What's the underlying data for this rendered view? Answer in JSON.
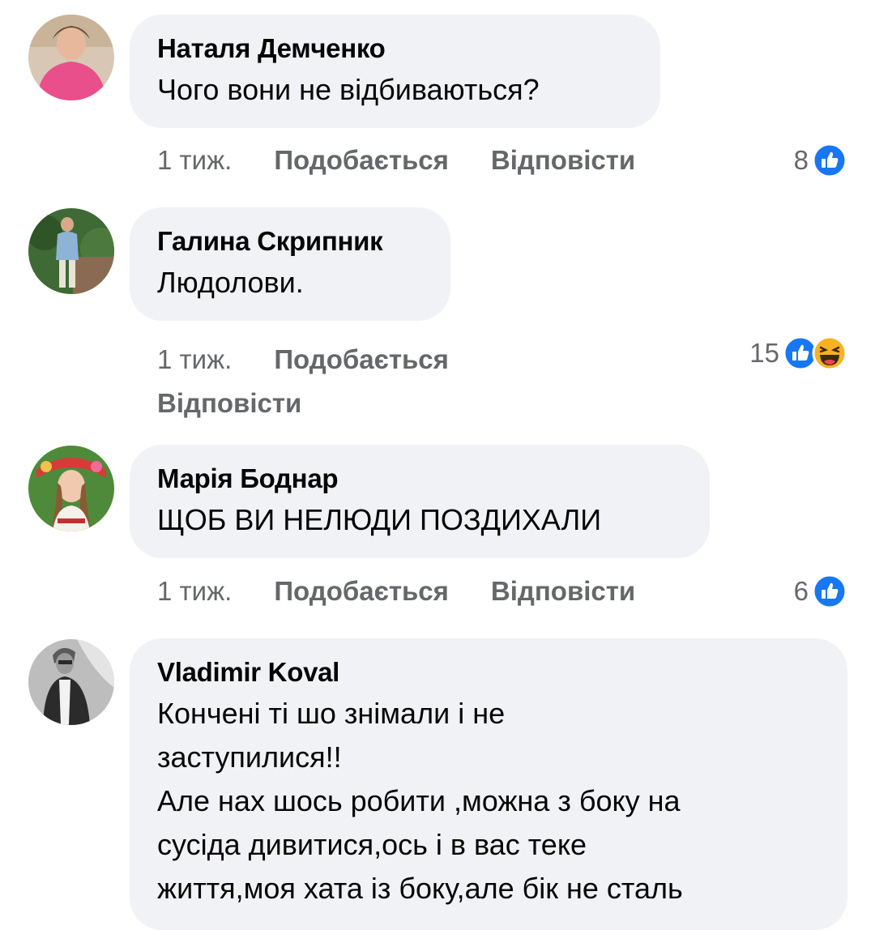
{
  "comments": [
    {
      "author": "Наталя Демченко",
      "text": [
        "Чого вони не відбиваються?"
      ],
      "time": "1 тиж.",
      "like": "Подобається",
      "reply": "Відповісти",
      "reaction_count": "8",
      "reactions": [
        "like-icon"
      ]
    },
    {
      "author": "Галина Скрипник",
      "text": [
        "Людолови."
      ],
      "time": "1 тиж.",
      "like": "Подобається",
      "reply": "Відповісти",
      "reaction_count": "15",
      "reactions": [
        "like-icon",
        "haha-icon"
      ]
    },
    {
      "author": "Марія Боднар",
      "text": [
        "ЩОБ ВИ НЕЛЮДИ ПОЗДИХАЛИ"
      ],
      "time": "1 тиж.",
      "like": "Подобається",
      "reply": "Відповісти",
      "reaction_count": "6",
      "reactions": [
        "like-icon"
      ]
    },
    {
      "author": "Vladimir Koval",
      "text": [
        "Кончені ті шо знімали і не",
        "заступилися!!",
        "Але нах шось робити ,можна з боку на",
        "сусіда дивитися,ось і в вас теке",
        "життя,моя хата із боку,але бік не сталь"
      ]
    }
  ],
  "colors": {
    "bubble": "#f0f2f5",
    "meta": "#65676b",
    "like_blue": "#1877f2",
    "haha_yellow": "#f7b125"
  }
}
